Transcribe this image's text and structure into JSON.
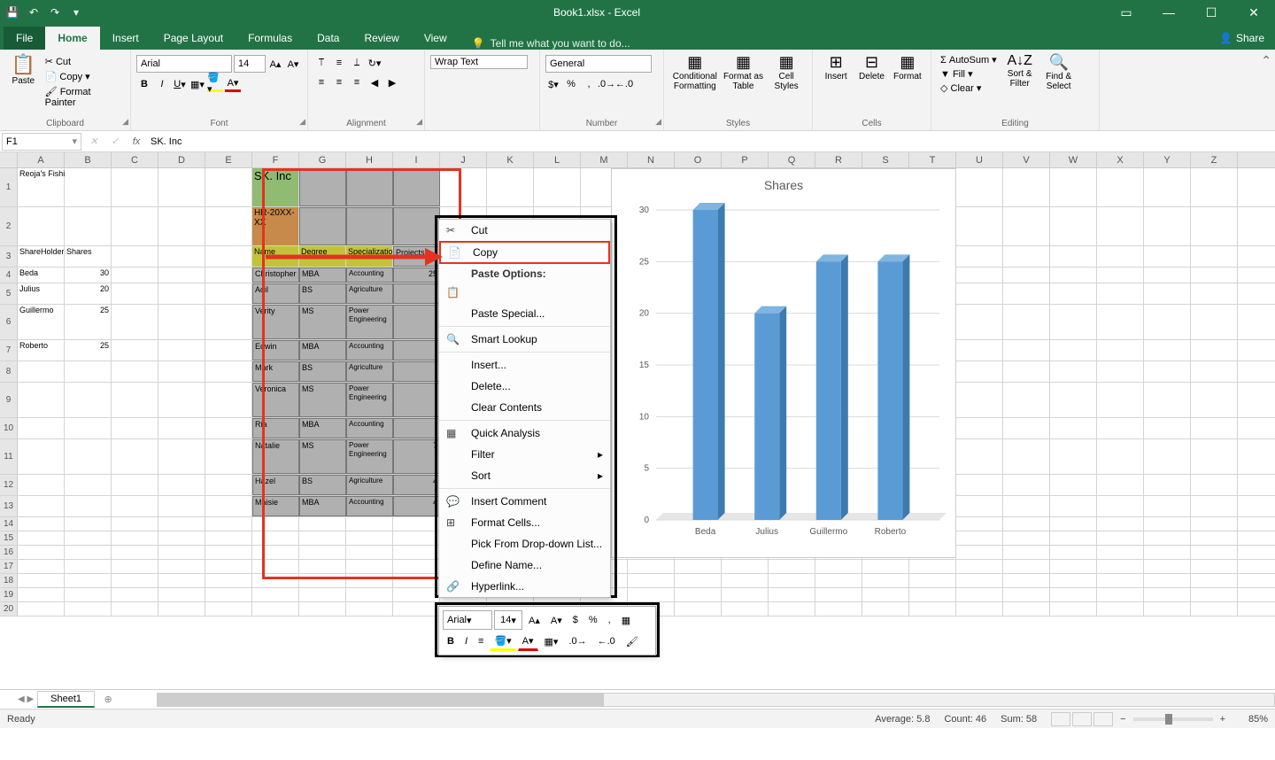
{
  "app": {
    "title": "Book1.xlsx - Excel"
  },
  "tabs": [
    "File",
    "Home",
    "Insert",
    "Page Layout",
    "Formulas",
    "Data",
    "Review",
    "View"
  ],
  "tellme": "Tell me what you want to do...",
  "share": "Share",
  "ribbon": {
    "clipboard": {
      "paste": "Paste",
      "cut": "Cut",
      "copy": "Copy",
      "format_painter": "Format Painter",
      "label": "Clipboard"
    },
    "font": {
      "name": "Arial",
      "size": "14",
      "label": "Font"
    },
    "alignment": {
      "wrap": "Wrap Text",
      "label": "Alignment"
    },
    "number": {
      "format": "General",
      "label": "Number"
    },
    "styles": {
      "cond": "Conditional Formatting",
      "table": "Format as Table",
      "cell": "Cell Styles",
      "label": "Styles"
    },
    "cells": {
      "insert": "Insert",
      "delete": "Delete",
      "format": "Format",
      "label": "Cells"
    },
    "editing": {
      "autosum": "AutoSum",
      "fill": "Fill",
      "clear": "Clear",
      "sort": "Sort & Filter",
      "find": "Find & Select",
      "label": "Editing"
    }
  },
  "formula_bar": {
    "name_box": "F1",
    "formula": "SK. Inc"
  },
  "columns": [
    "A",
    "B",
    "C",
    "D",
    "E",
    "F",
    "G",
    "H",
    "I",
    "J",
    "K",
    "L",
    "M",
    "N",
    "O",
    "P",
    "Q",
    "R",
    "S",
    "T",
    "U",
    "V",
    "W",
    "X",
    "Y",
    "Z"
  ],
  "sheet_a": {
    "company": "Reoja's Fishing Industry",
    "h_shareholder": "ShareHolder",
    "h_shares": "Shares",
    "rows": [
      {
        "name": "Beda",
        "shares": 30
      },
      {
        "name": "Julius",
        "shares": 20
      },
      {
        "name": "Guillermo",
        "shares": 25
      },
      {
        "name": "Roberto",
        "shares": 25
      }
    ]
  },
  "sheet_f": {
    "title": "SK. Inc",
    "hr": "HR-20XX-XX",
    "headers": [
      "Name",
      "Degree",
      "Specialization",
      "Projects"
    ],
    "rows": [
      {
        "name": "Christopher",
        "degree": "MBA",
        "spec": "Accounting",
        "proj": 25
      },
      {
        "name": "Adil",
        "degree": "BS",
        "spec": "Agriculture",
        "proj": ""
      },
      {
        "name": "Verity",
        "degree": "MS",
        "spec": "Power Engineering",
        "proj": ""
      },
      {
        "name": "Edwin",
        "degree": "MBA",
        "spec": "Accounting",
        "proj": ""
      },
      {
        "name": "Mark",
        "degree": "BS",
        "spec": "Agriculture",
        "proj": ""
      },
      {
        "name": "Veronica",
        "degree": "MS",
        "spec": "Power Engineering",
        "proj": ""
      },
      {
        "name": "Ria",
        "degree": "MBA",
        "spec": "Accounting",
        "proj": ""
      },
      {
        "name": "Natalie",
        "degree": "MS",
        "spec": "Power Engineering",
        "proj": 7
      },
      {
        "name": "Hazel",
        "degree": "BS",
        "spec": "Agriculture",
        "proj": 4
      },
      {
        "name": "Maisie",
        "degree": "MBA",
        "spec": "Accounting",
        "proj": 4
      }
    ]
  },
  "context_menu": {
    "cut": "Cut",
    "copy": "Copy",
    "paste_opts": "Paste Options:",
    "paste_special": "Paste Special...",
    "smart_lookup": "Smart Lookup",
    "insert": "Insert...",
    "delete": "Delete...",
    "clear": "Clear Contents",
    "quick": "Quick Analysis",
    "filter": "Filter",
    "sort": "Sort",
    "comment": "Insert Comment",
    "format_cells": "Format Cells...",
    "pick": "Pick From Drop-down List...",
    "define": "Define Name...",
    "hyperlink": "Hyperlink..."
  },
  "mini_toolbar": {
    "font": "Arial",
    "size": "14"
  },
  "chart_data": {
    "type": "bar",
    "title": "Shares",
    "categories": [
      "Beda",
      "Julius",
      "Guillermo",
      "Roberto"
    ],
    "values": [
      30,
      20,
      25,
      25
    ],
    "ylim": [
      0,
      30
    ],
    "yticks": [
      0,
      5,
      10,
      15,
      20,
      25,
      30
    ],
    "series_color": "#5b9bd5"
  },
  "sheet_tab": "Sheet1",
  "status": {
    "ready": "Ready",
    "avg": "Average: 5.8",
    "count": "Count: 46",
    "sum": "Sum: 58",
    "zoom": "85%"
  }
}
